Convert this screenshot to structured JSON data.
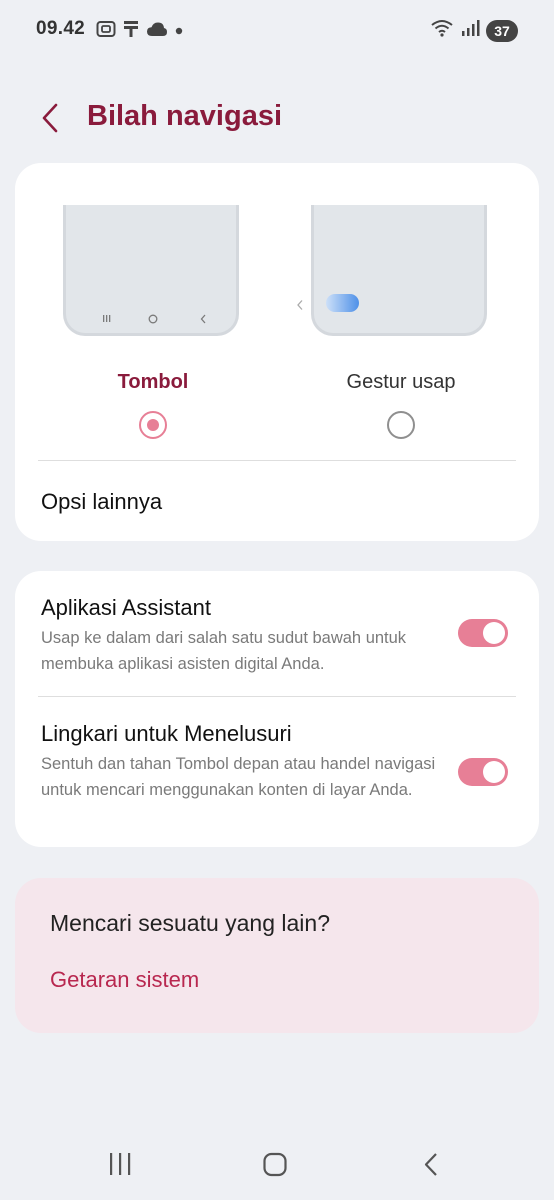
{
  "status_bar": {
    "time": "09.42",
    "battery_level": "37",
    "icons_left": [
      "screenshot-icon",
      "download-icon",
      "cloud-icon",
      "dot-icon"
    ],
    "icons_right": [
      "wifi-icon",
      "signal-icon",
      "battery-icon"
    ]
  },
  "header": {
    "title": "Bilah navigasi"
  },
  "navigation_type": {
    "options": [
      {
        "label": "Tombol",
        "selected": true
      },
      {
        "label": "Gestur usap",
        "selected": false
      }
    ],
    "more_options_label": "Opsi lainnya"
  },
  "toggles": [
    {
      "title": "Aplikasi Assistant",
      "description": "Usap ke dalam dari salah satu sudut bawah untuk membuka aplikasi asisten digital Anda.",
      "enabled": true
    },
    {
      "title": "Lingkari untuk Menelusuri",
      "description": "Sentuh dan tahan Tombol depan atau handel navigasi untuk mencari menggunakan konten di layar Anda.",
      "enabled": true
    }
  ],
  "suggestions": {
    "title": "Mencari sesuatu yang lain?",
    "link": "Getaran sistem"
  },
  "colors": {
    "accent": "#8a1b3c",
    "toggle_on": "#e77f96",
    "link": "#b8274f",
    "background": "#eef0f4",
    "suggest_card": "#f5e6ec"
  },
  "bottom_nav": [
    "recent-apps-icon",
    "home-icon",
    "back-icon"
  ]
}
